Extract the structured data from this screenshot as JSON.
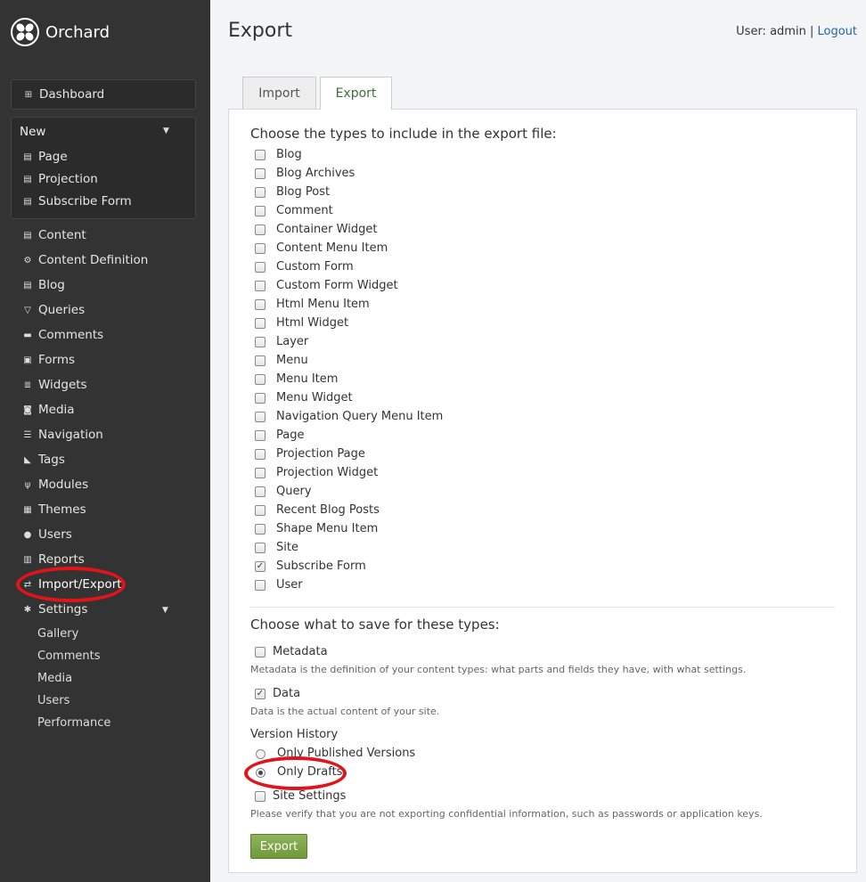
{
  "app": {
    "name": "Orchard"
  },
  "sidebar": {
    "dashboard": "Dashboard",
    "new": {
      "title": "New",
      "items": [
        "Page",
        "Projection",
        "Subscribe Form"
      ]
    },
    "items": [
      "Content",
      "Content Definition",
      "Blog",
      "Queries",
      "Comments",
      "Forms",
      "Widgets",
      "Media",
      "Navigation",
      "Tags",
      "Modules",
      "Themes",
      "Users",
      "Reports",
      "Import/Export",
      "Settings"
    ],
    "settings_items": [
      "Gallery",
      "Comments",
      "Media",
      "Users",
      "Performance"
    ]
  },
  "header": {
    "title": "Export",
    "user_label": "User: admin",
    "separator": "|",
    "logout": "Logout"
  },
  "tabs": [
    "Import",
    "Export"
  ],
  "types_heading": "Choose the types to include in the export file:",
  "types": [
    {
      "label": "Blog",
      "checked": false
    },
    {
      "label": "Blog Archives",
      "checked": false
    },
    {
      "label": "Blog Post",
      "checked": false
    },
    {
      "label": "Comment",
      "checked": false
    },
    {
      "label": "Container Widget",
      "checked": false
    },
    {
      "label": "Content Menu Item",
      "checked": false
    },
    {
      "label": "Custom Form",
      "checked": false
    },
    {
      "label": "Custom Form Widget",
      "checked": false
    },
    {
      "label": "Html Menu Item",
      "checked": false
    },
    {
      "label": "Html Widget",
      "checked": false
    },
    {
      "label": "Layer",
      "checked": false
    },
    {
      "label": "Menu",
      "checked": false
    },
    {
      "label": "Menu Item",
      "checked": false
    },
    {
      "label": "Menu Widget",
      "checked": false
    },
    {
      "label": "Navigation Query Menu Item",
      "checked": false
    },
    {
      "label": "Page",
      "checked": false
    },
    {
      "label": "Projection Page",
      "checked": false
    },
    {
      "label": "Projection Widget",
      "checked": false
    },
    {
      "label": "Query",
      "checked": false
    },
    {
      "label": "Recent Blog Posts",
      "checked": false
    },
    {
      "label": "Shape Menu Item",
      "checked": false
    },
    {
      "label": "Site",
      "checked": false
    },
    {
      "label": "Subscribe Form",
      "checked": true
    },
    {
      "label": "User",
      "checked": false
    }
  ],
  "save_heading": "Choose what to save for these types:",
  "metadata": {
    "label": "Metadata",
    "checked": false,
    "hint": "Metadata is the definition of your content types: what parts and fields they have, with what settings."
  },
  "data": {
    "label": "Data",
    "checked": true,
    "hint": "Data is the actual content of your site."
  },
  "version_history": {
    "label": "Version History",
    "options": [
      "Only Published Versions",
      "Only Drafts"
    ],
    "selected": "Only Drafts"
  },
  "site_settings": {
    "label": "Site Settings",
    "checked": false,
    "hint": "Please verify that you are not exporting confidential information, such as passwords or application keys."
  },
  "export_button": "Export",
  "check_mark": "✓",
  "highlight_color": "#e0141a"
}
